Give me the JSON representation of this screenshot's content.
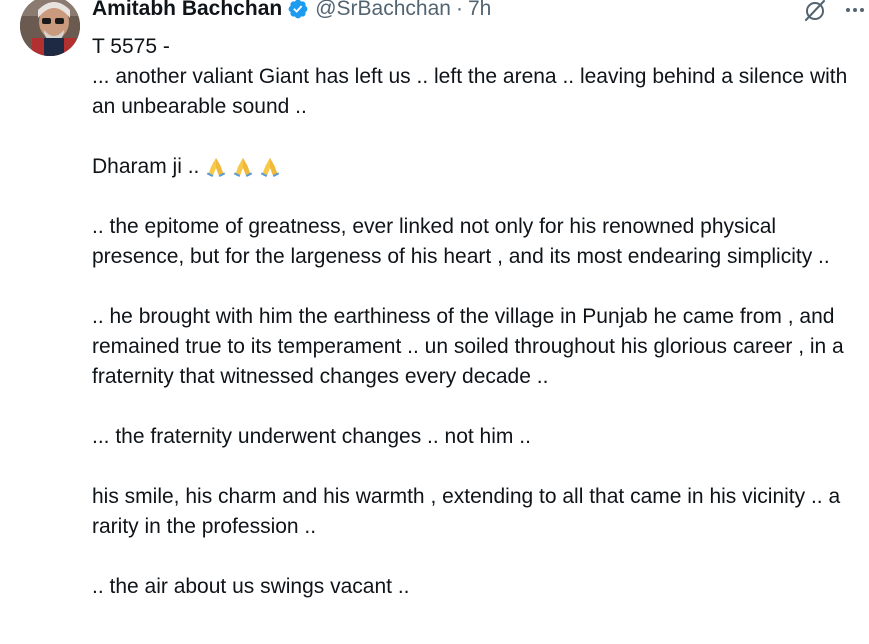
{
  "author": {
    "name": "Amitabh Bachchan",
    "handle": "@SrBachchan",
    "separator": "·",
    "time": "7h"
  },
  "icons": {
    "verified": "verified-badge-icon",
    "grok": "grok-icon",
    "more": "more-icon",
    "pray": "folded-hands-emoji"
  },
  "colors": {
    "text": "#0f1419",
    "secondary": "#536471",
    "verified": "#1d9bf0"
  },
  "tweet": {
    "id_line": "T 5575 -",
    "line1": "... another valiant Giant has left us ..  left the arena .. leaving behind a silence with an unbearable sound  ..",
    "dharam": "Dharam ji ..",
    "line3": ".. the epitome of  greatness,  ever linked not only for his renowned physical presence, but for the largeness of his heart , and its most endearing simplicity  ..",
    "line4": ".. he brought with him the earthiness of the village in Punjab he came from , and remained true to its temperament .. un soiled throughout his glorious career , in a fraternity that witnessed changes every decade ..",
    "line5": "... the fraternity underwent changes .. not him  ..",
    "line6": "his smile, his charm and his warmth , extending to all that came in his vicinity .. a rarity in the profession ..",
    "line7": ".. the air about us swings vacant .."
  }
}
